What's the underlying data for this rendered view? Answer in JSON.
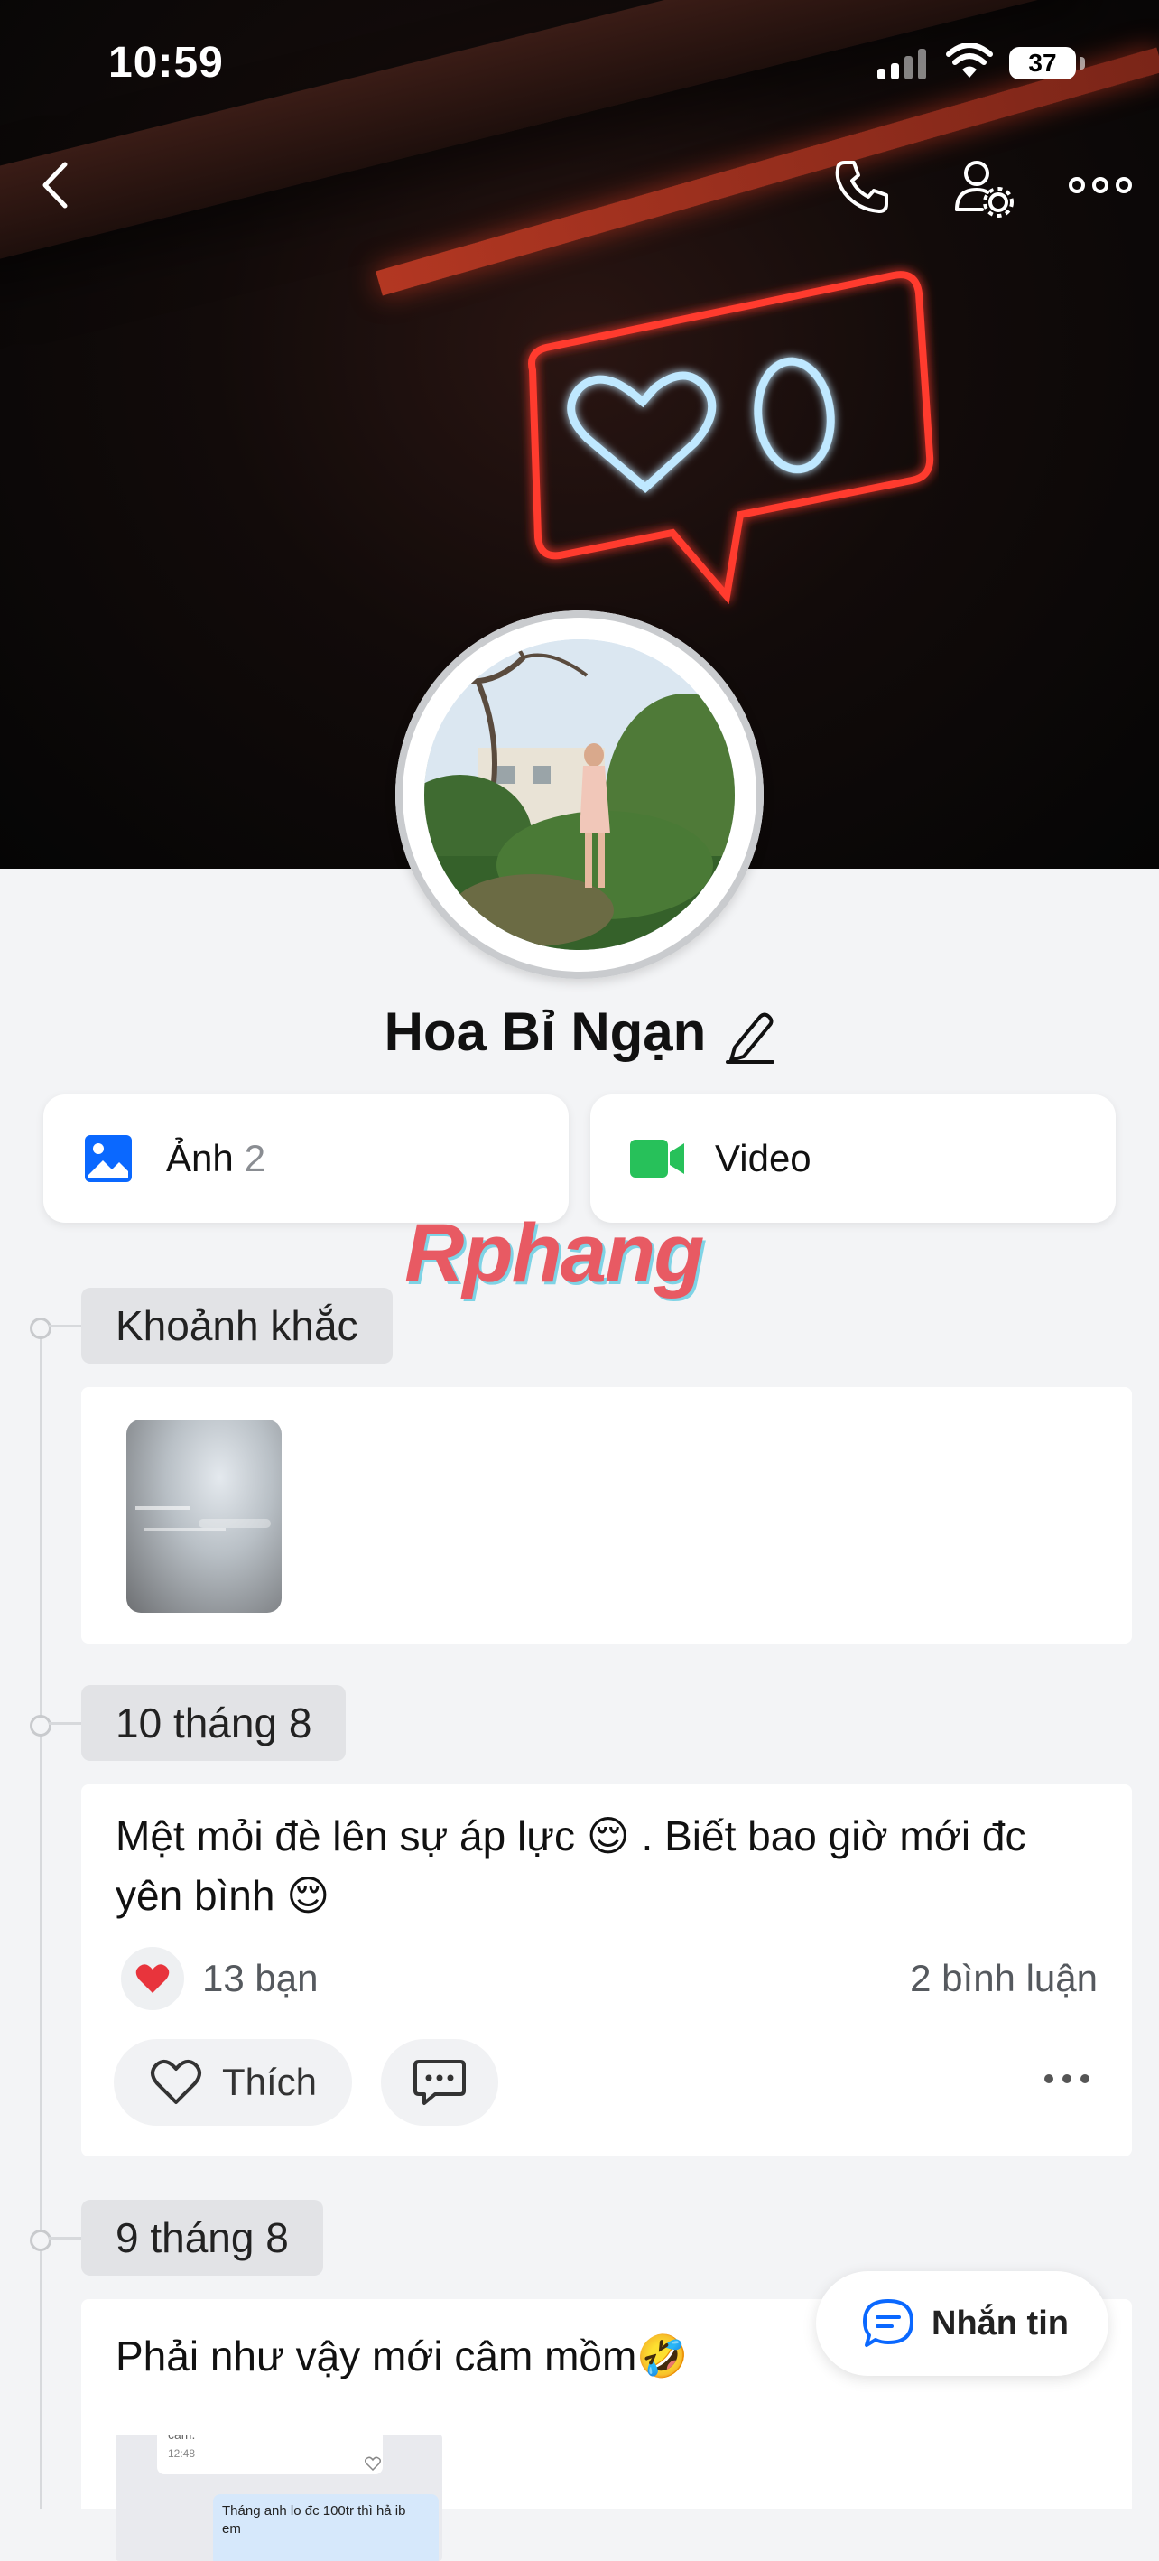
{
  "status_bar": {
    "time": "10:59",
    "battery": "37"
  },
  "profile": {
    "name": "Hoa Bỉ Ngạn"
  },
  "media_tabs": {
    "photos": {
      "label": "Ảnh",
      "count": "2"
    },
    "video": {
      "label": "Video"
    }
  },
  "watermark": "Rphang",
  "timeline": {
    "moments": {
      "label": "Khoảnh khắc"
    },
    "posts": [
      {
        "date": "10 tháng 8",
        "text_line1": "Mệt mỏi đè lên sự áp lực 😌 . Biết bao giờ mới đc",
        "text_line2": "yên bình 😌",
        "reaction_icon": "❤️",
        "reactions": "13 bạn",
        "comments": "2 bình luận",
        "like_label": "Thích"
      },
      {
        "date": "9 tháng 8",
        "text": "Phải như vậy mới câm mồm🤣",
        "preview": {
          "line1": "cam.",
          "time": "12:48",
          "line2": "Tháng anh lo đc 100tr thì hả ib",
          "line3": "em"
        }
      }
    ]
  },
  "message_button": {
    "label": "Nhắn tin"
  },
  "colors": {
    "accent_blue": "#0a68ff",
    "video_green": "#27c15a",
    "like_red": "#e8343c",
    "neon_red": "#ff3b2f",
    "neon_blue": "#bfe8ff"
  }
}
